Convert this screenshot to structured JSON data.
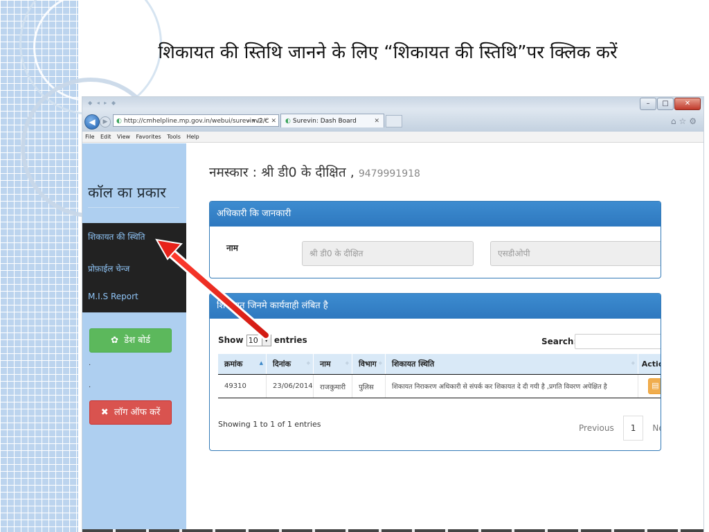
{
  "slide": {
    "title": "शिकायत की स्तिथि जानने के लिए “शिकायत की स्तिथि”पर क्लिक करें"
  },
  "browser": {
    "address": "http://cmhelpline.mp.gov.in/webui/surevinv2/c",
    "address_controls": "⌕ ▾ ⊡ C ✕",
    "tab_title": "Surevin: Dash Board",
    "menu": [
      "File",
      "Edit",
      "View",
      "Favorites",
      "Tools",
      "Help"
    ]
  },
  "sidebar": {
    "heading": "कॉल का प्रकार",
    "items": [
      {
        "label": "शिकायत की स्थिति"
      },
      {
        "label": "प्रोफ़ाईल चेन्ज"
      },
      {
        "label": "M.I.S Report"
      }
    ],
    "dashboard_label": "डेश  बोर्ड",
    "logout_label": "लॉग  ऑफ  करें",
    "dot1": ".",
    "dot2": "."
  },
  "greeting": {
    "text": "नमस्कार : श्री डी0 के दीक्षित ,",
    "phone": "9479991918"
  },
  "officer_panel": {
    "heading": "अधिकारी कि जानकारी",
    "name_label": "नाम",
    "name_value": "श्री डी0 के दीक्षित",
    "designation_value": "एसडीओपी"
  },
  "complaints_panel": {
    "heading": "शिकायत जिनमे कार्यवाही लंबित है",
    "show_label": "Show",
    "page_size": "10",
    "entries_label": "entries",
    "search_label": "Search:",
    "columns": [
      "क्रमांक",
      "दिनांक",
      "नाम",
      "विभाग",
      "शिकायत स्थिति",
      "Action"
    ],
    "rows": [
      [
        "49310",
        "23/06/2014",
        "राजकुमारी",
        "पुलिस",
        "शिकायत निराकरण अधिकारी से संपर्क कर शिकायत दे दी गयी है ,प्रगति विवरण अपेक्षित है"
      ]
    ],
    "showing_text": "Showing 1 to 1 of 1 entries",
    "previous_label": "Previous",
    "current_page": "1",
    "next_label": "Next"
  },
  "colors": {
    "sidebar_bg": "#aecff0",
    "nav_bg": "#222222",
    "panel_primary": "#337ab7",
    "success": "#5cb85c",
    "danger": "#d9534f",
    "warning": "#f0ad4e",
    "pointer_arrow": "#e8221a"
  },
  "icons": {
    "dashboard": "gear-icon",
    "logout": "close-icon",
    "action": "document-icon"
  }
}
